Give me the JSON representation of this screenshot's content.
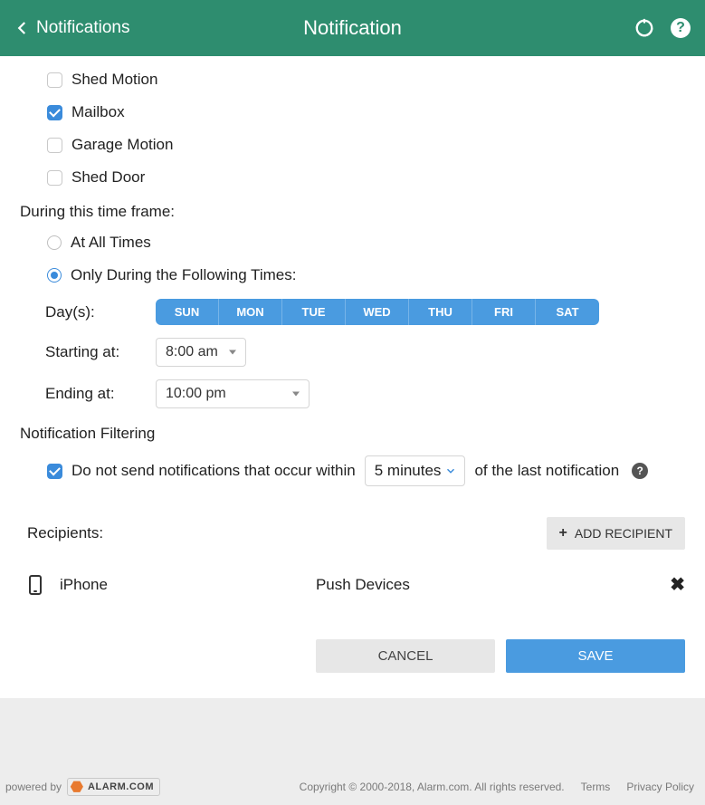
{
  "header": {
    "back_label": "Notifications",
    "title": "Notification"
  },
  "sensors": [
    {
      "label": "Shed Motion",
      "checked": false
    },
    {
      "label": "Mailbox",
      "checked": true
    },
    {
      "label": "Garage Motion",
      "checked": false
    },
    {
      "label": "Shed Door",
      "checked": false
    }
  ],
  "timeframe": {
    "section_label": "During this time frame:",
    "options": [
      {
        "label": "At All Times",
        "selected": false
      },
      {
        "label": "Only During the Following Times:",
        "selected": true
      }
    ],
    "days_label": "Day(s):",
    "days": [
      "SUN",
      "MON",
      "TUE",
      "WED",
      "THU",
      "FRI",
      "SAT"
    ],
    "start_label": "Starting at:",
    "start_value": "8:00 am",
    "end_label": "Ending at:",
    "end_value": "10:00 pm"
  },
  "filtering": {
    "section_label": "Notification Filtering",
    "checked": true,
    "prefix": "Do not send notifications that occur within",
    "window_value": "5 minutes",
    "suffix": "of the last notification"
  },
  "recipients": {
    "label": "Recipients:",
    "add_label": "ADD RECIPIENT",
    "items": [
      {
        "name": "iPhone",
        "channel": "Push Devices"
      }
    ]
  },
  "actions": {
    "cancel": "CANCEL",
    "save": "SAVE"
  },
  "footer": {
    "powered_by": "powered by",
    "brand": "ALARM.COM",
    "copyright": "Copyright © 2000-2018, Alarm.com. All rights reserved.",
    "terms": "Terms",
    "privacy": "Privacy Policy"
  }
}
